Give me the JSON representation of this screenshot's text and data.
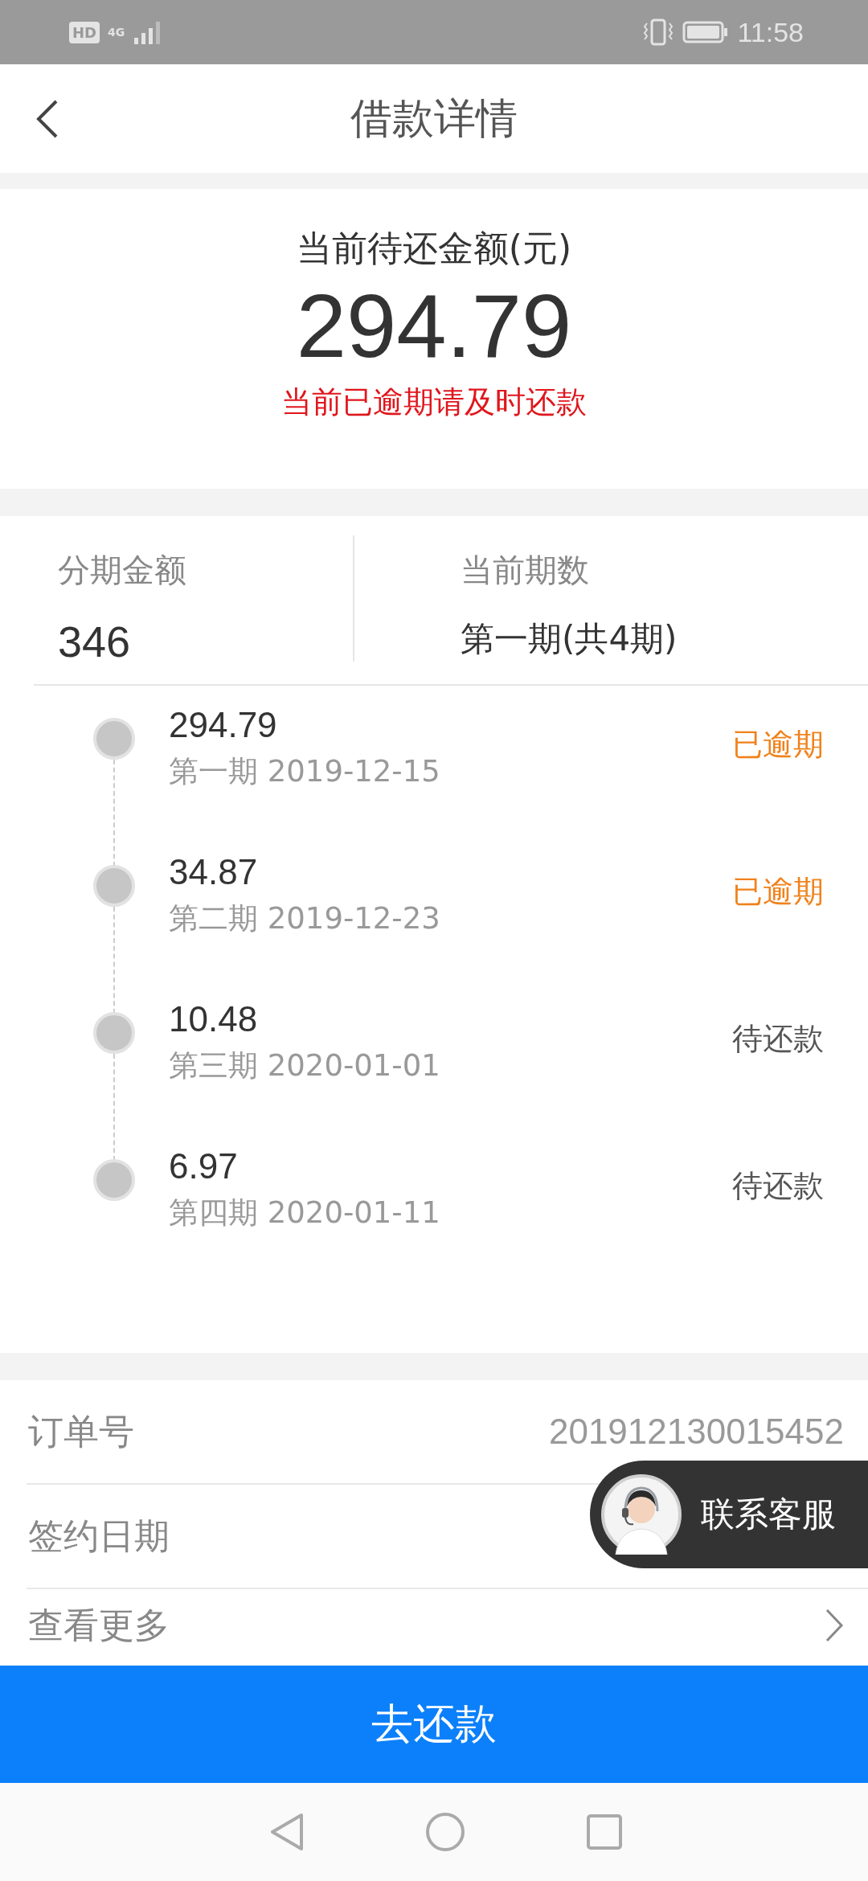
{
  "status_bar": {
    "time": "11:58",
    "network": "4G",
    "hd": "HD"
  },
  "header": {
    "title": "借款详情"
  },
  "summary": {
    "label": "当前待还金额(元)",
    "amount": "294.79",
    "warning": "当前已逾期请及时还款"
  },
  "plan": {
    "amount_label": "分期金额",
    "amount": "346",
    "period_label": "当前期数",
    "period": "第一期(共4期)"
  },
  "installments": [
    {
      "amount": "294.79",
      "due": "第一期 2019-12-15",
      "status": "已逾期",
      "overdue": true
    },
    {
      "amount": "34.87",
      "due": "第二期 2019-12-23",
      "status": "已逾期",
      "overdue": true
    },
    {
      "amount": "10.48",
      "due": "第三期 2020-01-01",
      "status": "待还款",
      "overdue": false
    },
    {
      "amount": "6.97",
      "due": "第四期 2020-01-11",
      "status": "待还款",
      "overdue": false
    }
  ],
  "details": [
    {
      "kind": "value",
      "label": "订单号",
      "value": "201912130015452"
    },
    {
      "kind": "value",
      "label": "签约日期"
    },
    {
      "kind": "link",
      "label": "查看更多"
    }
  ],
  "support": {
    "label": "联系客服"
  },
  "pay_button": "去还款"
}
